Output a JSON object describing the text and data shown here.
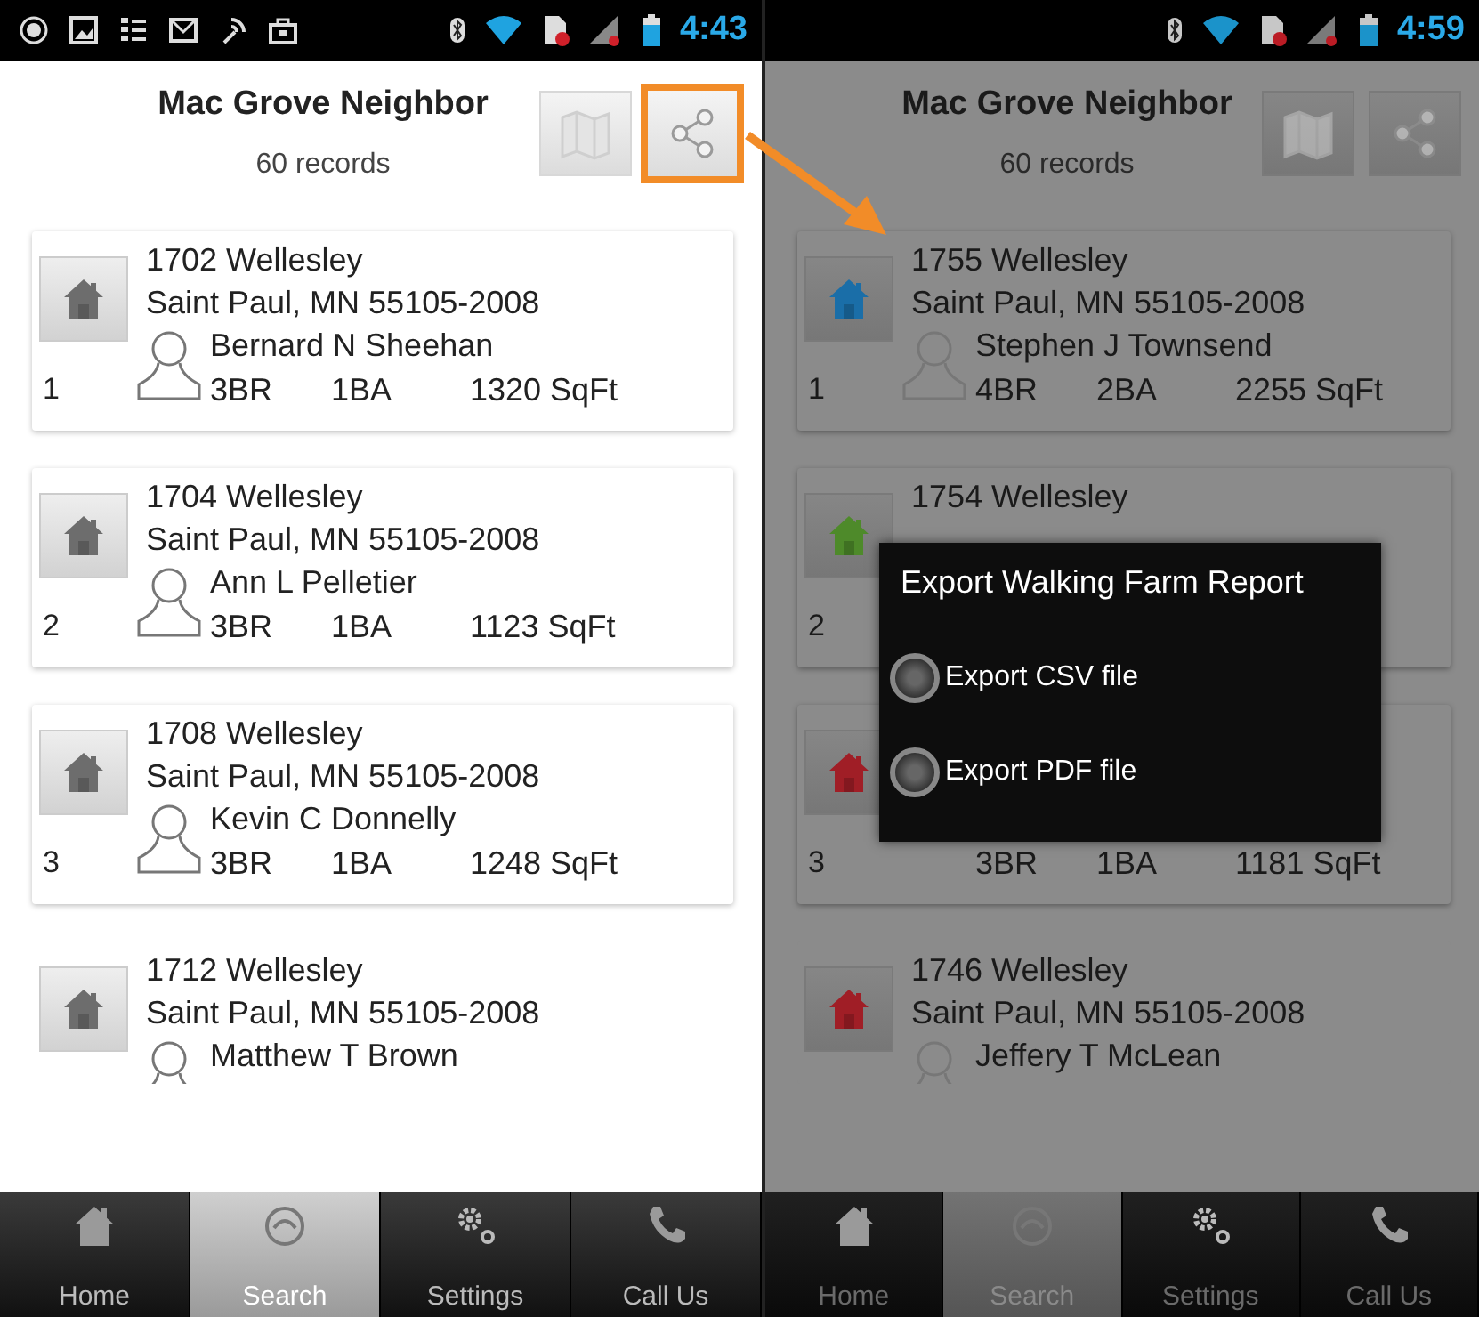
{
  "phones": [
    {
      "dimmed": false,
      "status_bar": {
        "notifications": true,
        "time": "4:43"
      },
      "header": {
        "title": "Mac Grove Neighbor",
        "subtitle": "60 records",
        "share_highlighted": true
      },
      "records": [
        {
          "number": "1",
          "street": "1702 Wellesley",
          "city": "Saint Paul, MN 55105-2008",
          "owner": "Bernard N Sheehan",
          "beds": "3BR",
          "baths": "1BA",
          "area": "1320 SqFt",
          "color": "#6d6d6d"
        },
        {
          "number": "2",
          "street": "1704 Wellesley",
          "city": "Saint Paul, MN 55105-2008",
          "owner": "Ann L Pelletier",
          "beds": "3BR",
          "baths": "1BA",
          "area": "1123 SqFt",
          "color": "#6d6d6d"
        },
        {
          "number": "3",
          "street": "1708 Wellesley",
          "city": "Saint Paul, MN 55105-2008",
          "owner": "Kevin C Donnelly",
          "beds": "3BR",
          "baths": "1BA",
          "area": "1248 SqFt",
          "color": "#6d6d6d"
        },
        {
          "street": "1712 Wellesley",
          "city": "Saint Paul, MN 55105-2008",
          "owner": "Matthew T Brown",
          "color": "#6d6d6d"
        }
      ],
      "nav": [
        {
          "kind": "home",
          "label": "Home",
          "selected": false
        },
        {
          "kind": "search",
          "label": "Search",
          "selected": true
        },
        {
          "kind": "settings",
          "label": "Settings",
          "selected": false
        },
        {
          "kind": "call",
          "label": "Call Us",
          "selected": false
        }
      ]
    },
    {
      "dimmed": true,
      "status_bar": {
        "notifications": false,
        "time": "4:59"
      },
      "header": {
        "title": "Mac Grove Neighbor",
        "subtitle": "60 records",
        "share_highlighted": false
      },
      "records": [
        {
          "number": "1",
          "street": "1755 Wellesley",
          "city": "Saint Paul, MN 55105-2008",
          "owner": "Stephen J Townsend",
          "beds": "4BR",
          "baths": "2BA",
          "area": "2255 SqFt",
          "color": "#1a6ea8"
        },
        {
          "number": "2",
          "street": "1754 Wellesley",
          "color": "#4e8a2a"
        },
        {
          "number": "3",
          "beds": "3BR",
          "baths": "1BA",
          "area": "1181 SqFt",
          "color": "#a01e26"
        },
        {
          "street": "1746 Wellesley",
          "city": "Saint Paul, MN 55105-2008",
          "owner": "Jeffery T McLean",
          "color": "#a01e26"
        }
      ],
      "nav": [
        {
          "kind": "home",
          "label": "Home",
          "selected": false
        },
        {
          "kind": "search",
          "label": "Search",
          "selected": true
        },
        {
          "kind": "settings",
          "label": "Settings",
          "selected": false
        },
        {
          "kind": "call",
          "label": "Call Us",
          "selected": false
        }
      ],
      "dialog": {
        "title": "Export Walking Farm Report",
        "options": [
          {
            "label": "Export CSV file",
            "selected": false
          },
          {
            "label": "Export PDF file",
            "selected": false
          }
        ]
      }
    }
  ]
}
